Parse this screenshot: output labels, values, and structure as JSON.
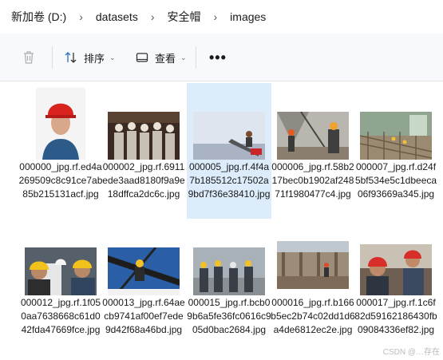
{
  "breadcrumb": [
    "新加卷 (D:)",
    "datasets",
    "安全帽",
    "images"
  ],
  "toolbar": {
    "sort_label": "排序",
    "view_label": "查看",
    "more_label": "•••"
  },
  "files": [
    {
      "name": "000000_jpg.rf.ed4a269509c8c91ce7ab85b215131acf.jpg",
      "selected": false
    },
    {
      "name": "000002_jpg.rf.6911ede3aad8180f9a9e18dffca2dc6c.jpg",
      "selected": false
    },
    {
      "name": "000005_jpg.rf.4f4a7b185512c17502a9bd7f36e38410.jpg",
      "selected": true
    },
    {
      "name": "000006_jpg.rf.58b217bec0b1902af24871f1980477c4.jpg",
      "selected": false
    },
    {
      "name": "000007_jpg.rf.d24f5bf534e5c1dbeeca06f93669a345.jpg",
      "selected": false
    },
    {
      "name": "000012_jpg.rf.1f050aa7638668c61d042fda47669fce.jpg",
      "selected": false
    },
    {
      "name": "000013_jpg.rf.64aecb9741af00ef7ede9d42f68a46bd.jpg",
      "selected": false
    },
    {
      "name": "000015_jpg.rf.bcb09b6a5fe36fc0616c905d0bac2684.jpg",
      "selected": false
    },
    {
      "name": "000016_jpg.rf.b166b5ec2b74c02dd1d6a4de6812ec2e.jpg",
      "selected": false
    },
    {
      "name": "000017_jpg.rf.1c6f82d59162186430fb09084336ef82.jpg",
      "selected": false
    }
  ],
  "watermark": "CSDN @…存在",
  "colors": {
    "selection": "#dcecfb",
    "toolbar_bg": "#f7f9fc"
  }
}
